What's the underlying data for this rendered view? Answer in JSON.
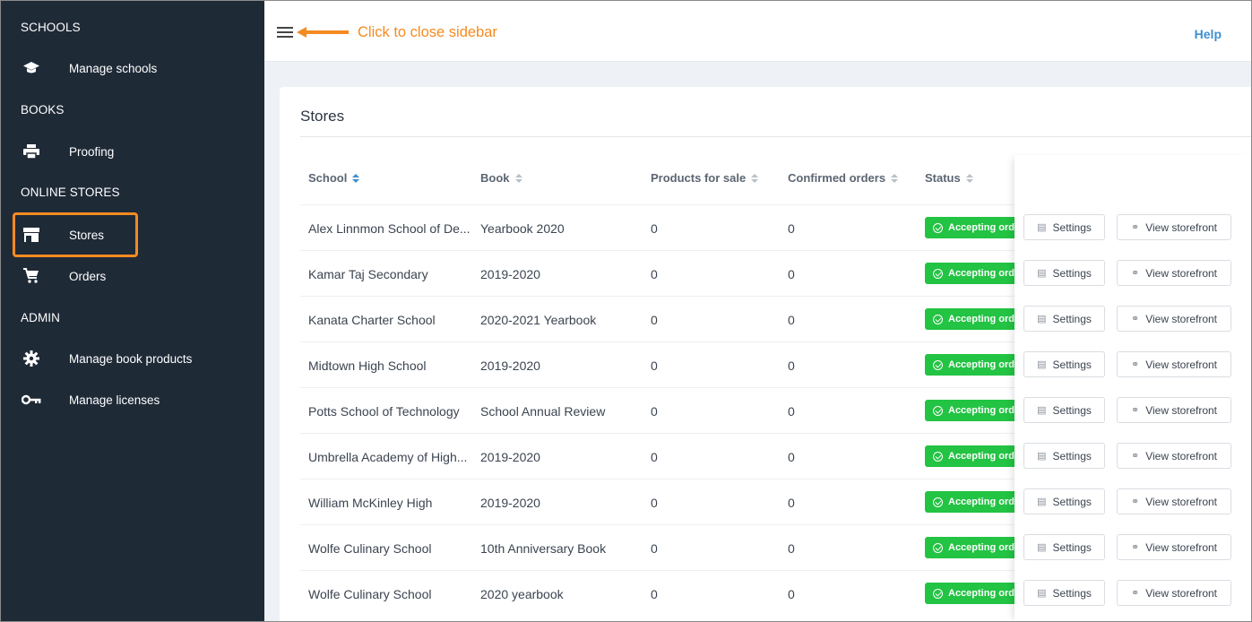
{
  "sidebar": {
    "sections": [
      {
        "title": "SCHOOLS"
      },
      {
        "title": "BOOKS"
      },
      {
        "title": "ONLINE STORES"
      },
      {
        "title": "ADMIN"
      }
    ],
    "items": [
      {
        "label": "Manage schools",
        "icon": "graduation-cap-icon"
      },
      {
        "label": "Proofing",
        "icon": "printer-icon"
      },
      {
        "label": "Stores",
        "icon": "store-icon"
      },
      {
        "label": "Orders",
        "icon": "cart-icon"
      },
      {
        "label": "Manage book products",
        "icon": "gear-icon"
      },
      {
        "label": "Manage licenses",
        "icon": "key-icon"
      }
    ],
    "active": "Stores"
  },
  "topbar": {
    "annotation": "Click to close sidebar",
    "help": "Help"
  },
  "card": {
    "title": "Stores"
  },
  "table": {
    "headers": [
      "School",
      "Book",
      "Products for sale",
      "Confirmed orders",
      "Status"
    ],
    "rows": [
      {
        "school": "Alex Linnmon School of De...",
        "book": "Yearbook 2020",
        "products": "0",
        "orders": "0",
        "status": "Accepting orders"
      },
      {
        "school": "Kamar Taj Secondary",
        "book": "2019-2020",
        "products": "0",
        "orders": "0",
        "status": "Accepting orders"
      },
      {
        "school": "Kanata Charter School",
        "book": "2020-2021 Yearbook",
        "products": "0",
        "orders": "0",
        "status": "Accepting orders"
      },
      {
        "school": "Midtown High School",
        "book": "2019-2020",
        "products": "0",
        "orders": "0",
        "status": "Accepting orders"
      },
      {
        "school": "Potts School of Technology",
        "book": "School Annual Review",
        "products": "0",
        "orders": "0",
        "status": "Accepting orders"
      },
      {
        "school": "Umbrella Academy of High...",
        "book": "2019-2020",
        "products": "0",
        "orders": "0",
        "status": "Accepting orders"
      },
      {
        "school": "William McKinley High",
        "book": "2019-2020",
        "products": "0",
        "orders": "0",
        "status": "Accepting orders"
      },
      {
        "school": "Wolfe Culinary School",
        "book": "10th Anniversary Book",
        "products": "0",
        "orders": "0",
        "status": "Accepting orders"
      },
      {
        "school": "Wolfe Culinary School",
        "book": "2020 yearbook",
        "products": "0",
        "orders": "0",
        "status": "Accepting orders"
      }
    ],
    "actions": {
      "settings": "Settings",
      "view": "View storefront"
    }
  },
  "colors": {
    "sidebar_bg": "#1f2a37",
    "accent": "#3e8ed0",
    "annotation": "#f48b21",
    "status_green": "#23c343"
  }
}
